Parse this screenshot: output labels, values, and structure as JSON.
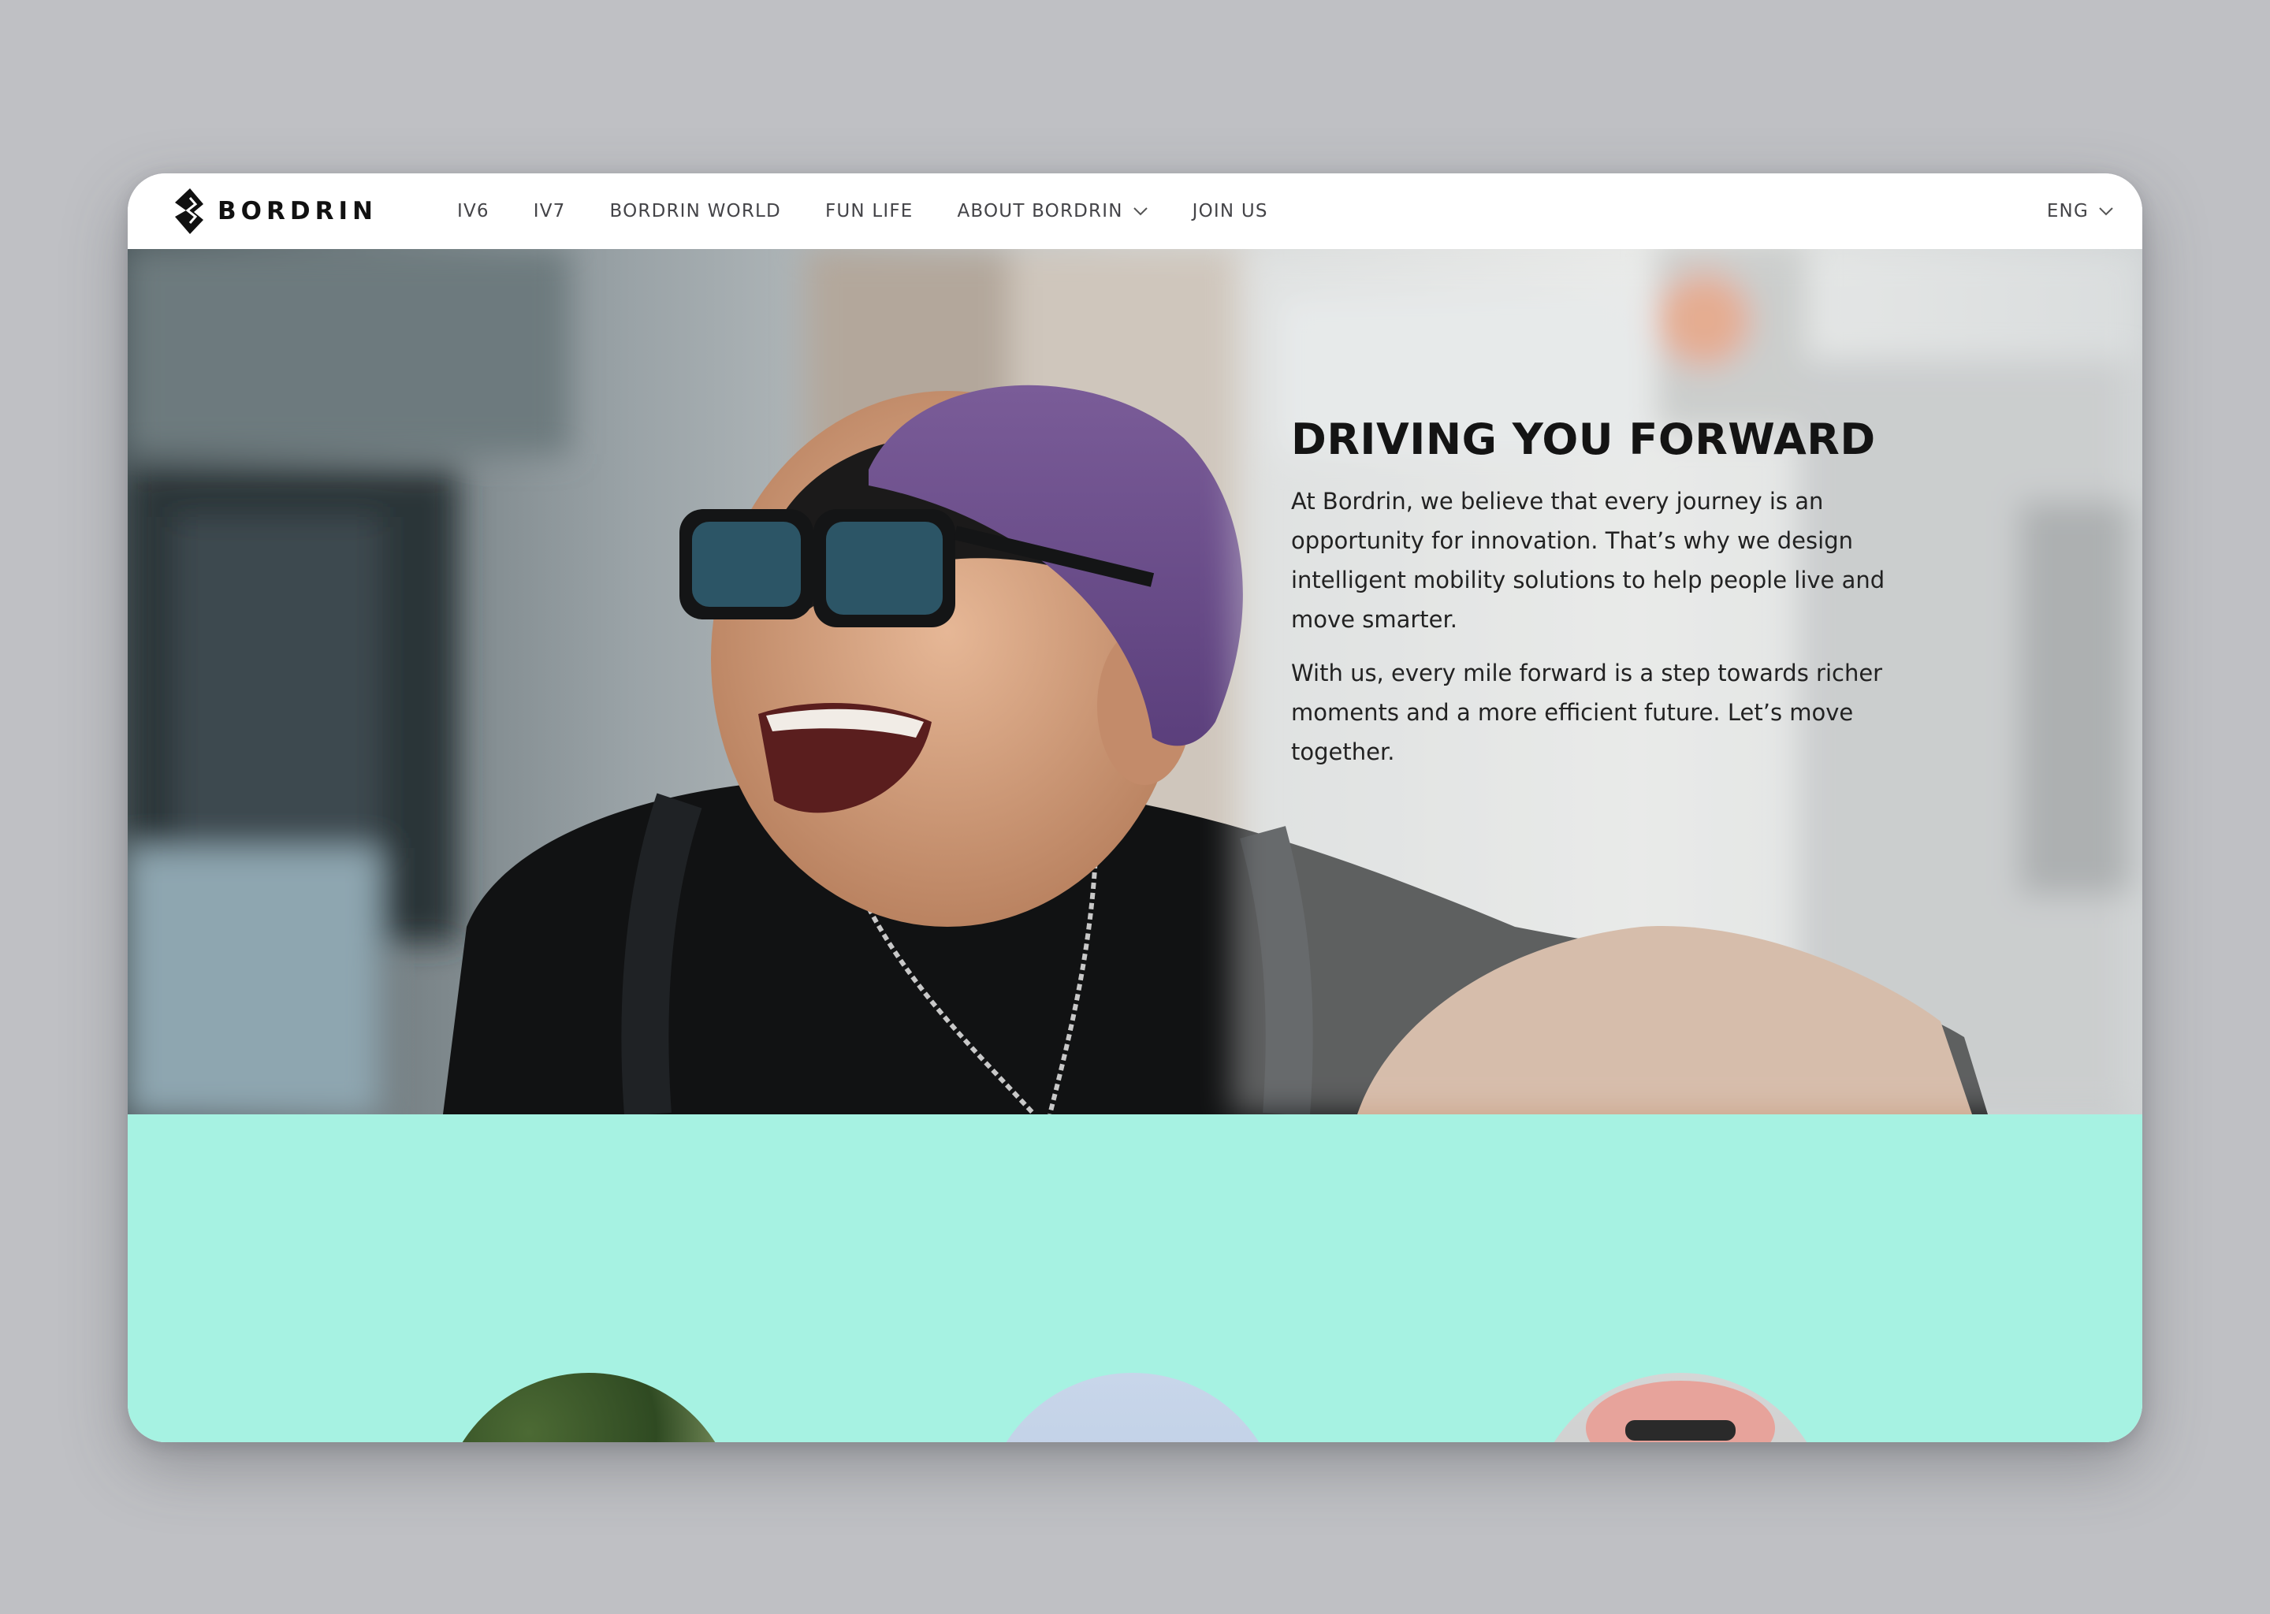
{
  "brand": {
    "name": "BORDRIN"
  },
  "nav": {
    "items": [
      {
        "label": "IV6"
      },
      {
        "label": "IV7"
      },
      {
        "label": "BORDRIN WORLD"
      },
      {
        "label": "FUN LIFE"
      },
      {
        "label": "ABOUT BORDRIN",
        "has_dropdown": true
      },
      {
        "label": "JOIN US"
      }
    ],
    "language": "ENG"
  },
  "hero": {
    "title": "DRIVING YOU FORWARD",
    "paragraphs": [
      "At Bordrin, we believe that every journey is an opportunity for innovation. That’s why we design intelligent mobility solutions to help people live and move smarter.",
      "With us, every mile forward is a step towards richer moments and a more efficient future. Let’s move together."
    ]
  },
  "colors": {
    "page_background": "#bfc0c4",
    "nav_background": "#ffffff",
    "mint_section": "#a6f2e2",
    "title_text": "#141414"
  }
}
